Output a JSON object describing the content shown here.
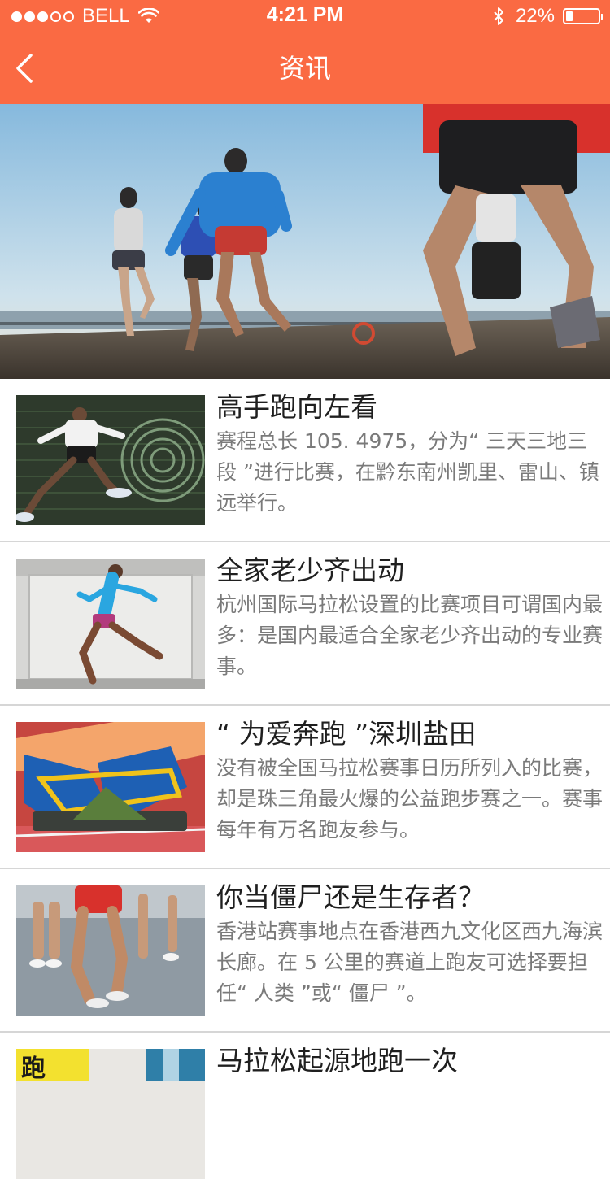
{
  "status_bar": {
    "carrier": "BELL",
    "time": "4:21 PM",
    "battery_percent": "22%",
    "battery_level": 0.22,
    "signal_bars": 3,
    "icons": [
      "wifi-icon",
      "bluetooth-icon",
      "battery-icon"
    ]
  },
  "nav": {
    "title": "资讯",
    "back_icon": "chevron-left-icon"
  },
  "banner": {
    "page_count": 5,
    "active_index": 2
  },
  "articles": [
    {
      "title": "高手跑向左看",
      "desc": "赛程总长 105. 4975，分为“ 三天三地三段 ”进行比赛，在黔东南州凯里、雷山、镇远举行。"
    },
    {
      "title": "全家老少齐出动",
      "desc": "杭州国际马拉松设置的比赛项目可谓国内最多：是国内最适合全家老少齐出动的专业赛事。"
    },
    {
      "title": "“ 为爱奔跑 ”深圳盐田",
      "desc": "没有被全国马拉松赛事日历所列入的比赛，却是珠三角最火爆的公益跑步赛之一。赛事每年有万名跑友参与。"
    },
    {
      "title": "你当僵尸还是生存者？",
      "desc": "香港站赛事地点在香港西九文化区西九海滨长廊。在 5 公里的赛道上跑友可选择要担任“ 人类 ”或“ 僵尸 ”。"
    },
    {
      "title": "马拉松起源地跑一次",
      "desc": ""
    }
  ],
  "colors": {
    "accent": "#fa6a43",
    "divider": "#d6d6d6",
    "title_text": "#1f1f1f",
    "desc_text": "#7a7a7a"
  }
}
